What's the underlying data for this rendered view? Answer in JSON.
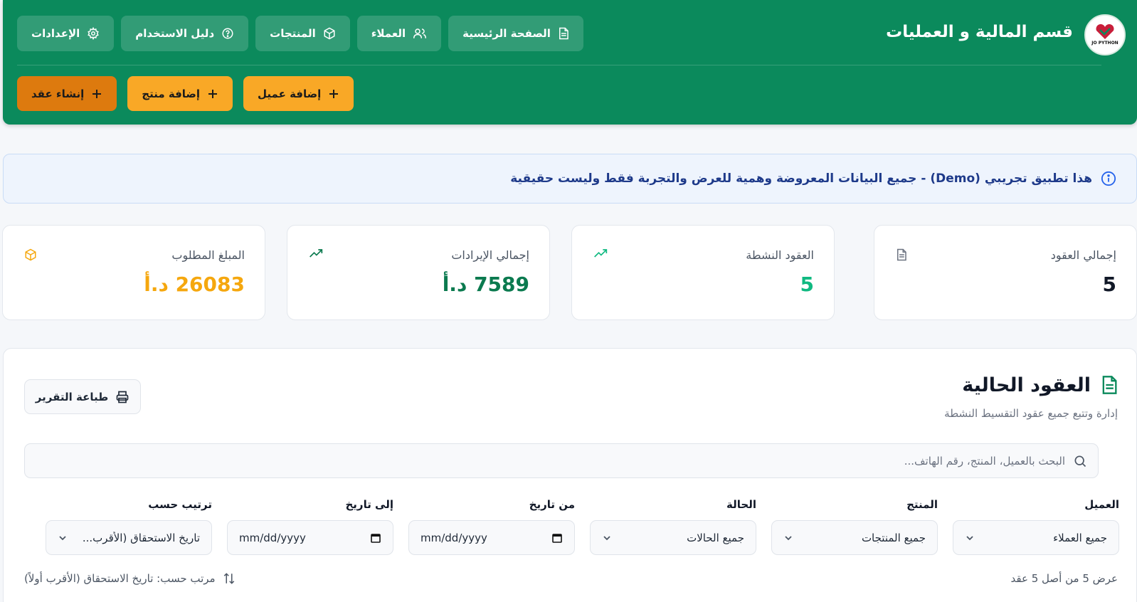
{
  "header": {
    "app_title": "قسم المالية و العمليات",
    "logo_text": "JO PYTHON",
    "nav": [
      {
        "label": "الصفحة الرئيسية",
        "icon": "document-icon"
      },
      {
        "label": "العملاء",
        "icon": "users-icon"
      },
      {
        "label": "المنتجات",
        "icon": "box-icon"
      },
      {
        "label": "دليل الاستخدام",
        "icon": "help-circle-icon"
      },
      {
        "label": "الإعدادات",
        "icon": "gear-icon"
      }
    ],
    "actions": [
      {
        "label": "إضافة عميل",
        "icon": "plus-icon"
      },
      {
        "label": "إضافة منتج",
        "icon": "plus-icon"
      },
      {
        "label": "إنشاء عقد",
        "icon": "plus-icon"
      }
    ]
  },
  "notice": {
    "text": "هذا تطبيق تجريبي (Demo) - جميع البيانات المعروضة وهمية للعرض والتجربة فقط وليست حقيقية",
    "icon": "info-icon"
  },
  "stats": [
    {
      "label": "إجمالي العقود",
      "value": "5",
      "icon": "document-icon",
      "color": "#111827"
    },
    {
      "label": "العقود النشطة",
      "value": "5",
      "icon": "trending-up-icon",
      "color": "#10b981"
    },
    {
      "label": "إجمالي الإيرادات",
      "value": "7589 د.أ",
      "icon": "trending-up-icon",
      "color": "#0b7a4f"
    },
    {
      "label": "المبلغ المطلوب",
      "value": "26083 د.أ",
      "icon": "box-icon",
      "color": "#f5a70e"
    }
  ],
  "contracts": {
    "title": "العقود الحالية",
    "subtitle": "إدارة وتتبع جميع عقود التقسيط النشطة",
    "print_label": "طباعة التقرير",
    "search_placeholder": "البحث بالعميل، المنتج، رقم الهاتف...",
    "filters": [
      {
        "label": "العميل",
        "value": "جميع العملاء",
        "type": "select"
      },
      {
        "label": "المنتج",
        "value": "جميع المنتجات",
        "type": "select"
      },
      {
        "label": "الحالة",
        "value": "جميع الحالات",
        "type": "select"
      },
      {
        "label": "من تاريخ",
        "value": "mm/dd/yyyy",
        "type": "date"
      },
      {
        "label": "إلى تاريخ",
        "value": "mm/dd/yyyy",
        "type": "date"
      },
      {
        "label": "ترتيب حسب",
        "value": "تاريخ الاستحقاق (الأقرب...",
        "type": "select"
      }
    ],
    "count_text": "عرض 5 من أصل 5 عقد",
    "sort_text": "مرتب حسب: تاريخ الاستحقاق (الأقرب أولاً)"
  },
  "colors": {
    "header_bg": "#0b8a5c",
    "action_bg": "#f9a826",
    "action_primary_bg": "#dd7a0e",
    "notice_text": "#1e3a8a"
  }
}
